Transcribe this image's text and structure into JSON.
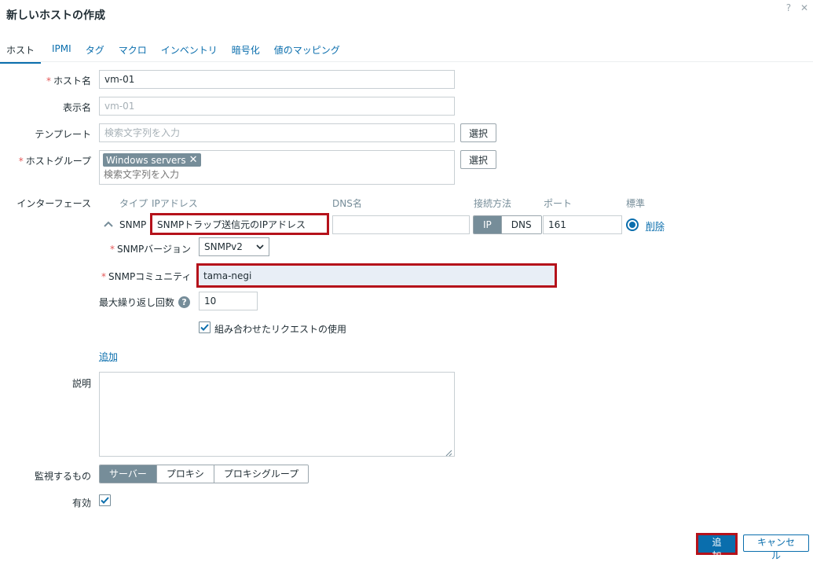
{
  "dialog": {
    "title": "新しいホストの作成",
    "help_icon": "?",
    "close_icon": "✕"
  },
  "tabs": [
    "ホスト",
    "IPMI",
    "タグ",
    "マクロ",
    "インベントリ",
    "暗号化",
    "値のマッピング"
  ],
  "form": {
    "host_name": {
      "label": "ホスト名",
      "value": "vm-01"
    },
    "visible_name": {
      "label": "表示名",
      "placeholder": "vm-01"
    },
    "templates": {
      "label": "テンプレート",
      "placeholder": "検索文字列を入力",
      "button": "選択"
    },
    "host_groups": {
      "label": "ホストグループ",
      "chip": "Windows servers",
      "placeholder": "検索文字列を入力",
      "button": "選択"
    },
    "interfaces": {
      "label": "インターフェース",
      "columns": {
        "type": "タイプ",
        "ip": "IPアドレス",
        "dns": "DNS名",
        "connect": "接続方法",
        "port": "ポート",
        "default": "標準"
      },
      "row": {
        "type": "SNMP",
        "ip_value": "SNMPトラップ送信元のIPアドレス",
        "dns_value": "",
        "connect_options": [
          "IP",
          "DNS"
        ],
        "connect_selected": "IP",
        "port": "161",
        "remove_link": "削除"
      },
      "snmp_version": {
        "label": "SNMPバージョン",
        "value": "SNMPv2"
      },
      "snmp_community": {
        "label": "SNMPコミュニティ",
        "value": "tama-negi"
      },
      "max_repetitions": {
        "label": "最大繰り返し回数",
        "value": "10",
        "help": "?"
      },
      "bulk": {
        "label": "組み合わせたリクエストの使用",
        "checked": true
      },
      "add_link": "追加"
    },
    "description": {
      "label": "説明",
      "value": ""
    },
    "monitored_by": {
      "label": "監視するもの",
      "options": [
        "サーバー",
        "プロキシ",
        "プロキシグループ"
      ],
      "selected": "サーバー"
    },
    "enabled": {
      "label": "有効",
      "checked": true
    }
  },
  "footer": {
    "add_button": "追加",
    "cancel_button": "キャンセル"
  },
  "colors": {
    "accent": "#0a6ead",
    "highlight_border": "#b5121b",
    "required": "#e45959",
    "segment_selected": "#768d99"
  }
}
